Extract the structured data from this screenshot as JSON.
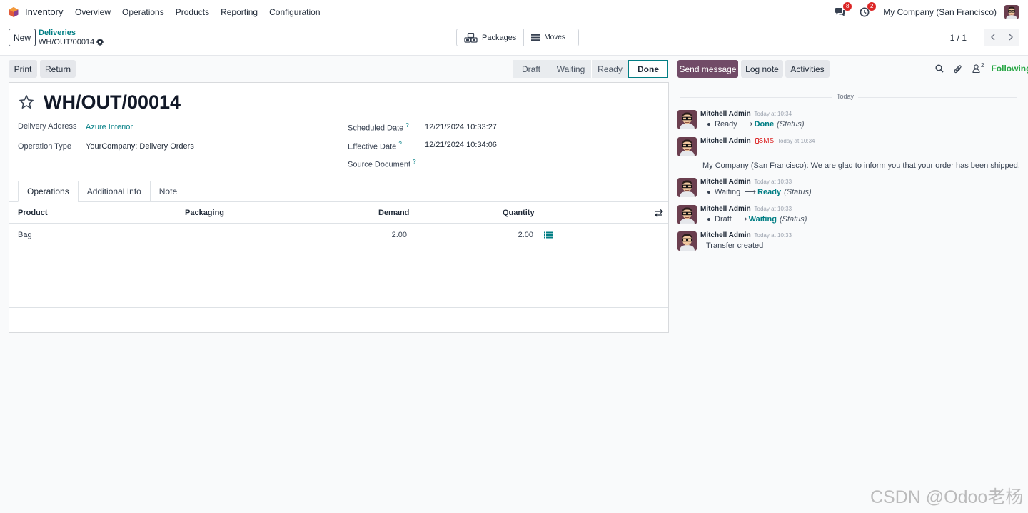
{
  "navbar": {
    "app_name": "Inventory",
    "menu": [
      "Overview",
      "Operations",
      "Products",
      "Reporting",
      "Configuration"
    ],
    "messages_count": "8",
    "activities_count": "2",
    "company": "My Company (San Francisco)"
  },
  "control": {
    "new_label": "New",
    "breadcrumb_parent": "Deliveries",
    "breadcrumb_current": "WH/OUT/00014",
    "smart_packages": "Packages",
    "smart_moves": "Moves",
    "pager": "1 / 1"
  },
  "statusbar": {
    "print": "Print",
    "return": "Return",
    "stages": [
      "Draft",
      "Waiting",
      "Ready",
      "Done"
    ],
    "current": "Done"
  },
  "record": {
    "title": "WH/OUT/00014",
    "delivery_address_label": "Delivery Address",
    "delivery_address": "Azure Interior",
    "operation_type_label": "Operation Type",
    "operation_type": "YourCompany: Delivery Orders",
    "scheduled_date_label": "Scheduled Date",
    "scheduled_date": "12/21/2024 10:33:27",
    "effective_date_label": "Effective Date",
    "effective_date": "12/21/2024 10:34:06",
    "source_document_label": "Source Document",
    "help_mark": "?"
  },
  "tabs": [
    "Operations",
    "Additional Info",
    "Note"
  ],
  "table": {
    "headers": [
      "Product",
      "Packaging",
      "Demand",
      "Quantity"
    ],
    "rows": [
      {
        "product": "Bag",
        "packaging": "",
        "demand": "2.00",
        "quantity": "2.00"
      }
    ]
  },
  "chatter": {
    "send_message": "Send message",
    "log_note": "Log note",
    "activities": "Activities",
    "followers_count": "2",
    "following": "Following",
    "separator": "Today",
    "messages": [
      {
        "author": "Mitchell Admin",
        "time": "Today at 10:34",
        "old": "Ready",
        "new": "Done",
        "field": "(Status)"
      },
      {
        "author": "Mitchell Admin",
        "sms": "SMS",
        "time": "Today at 10:34",
        "body": "My Company (San Francisco): We are glad to inform you that your order has been shipped."
      },
      {
        "author": "Mitchell Admin",
        "time": "Today at 10:33",
        "old": "Waiting",
        "new": "Ready",
        "field": "(Status)"
      },
      {
        "author": "Mitchell Admin",
        "time": "Today at 10:33",
        "old": "Draft",
        "new": "Waiting",
        "field": "(Status)"
      },
      {
        "author": "Mitchell Admin",
        "time": "Today at 10:33",
        "body": "Transfer created"
      }
    ]
  },
  "watermark": "CSDN @Odoo老杨",
  "colors": {
    "primary": "#714b67",
    "link": "#017e84",
    "following": "#28a745",
    "badge": "#dc2626"
  }
}
